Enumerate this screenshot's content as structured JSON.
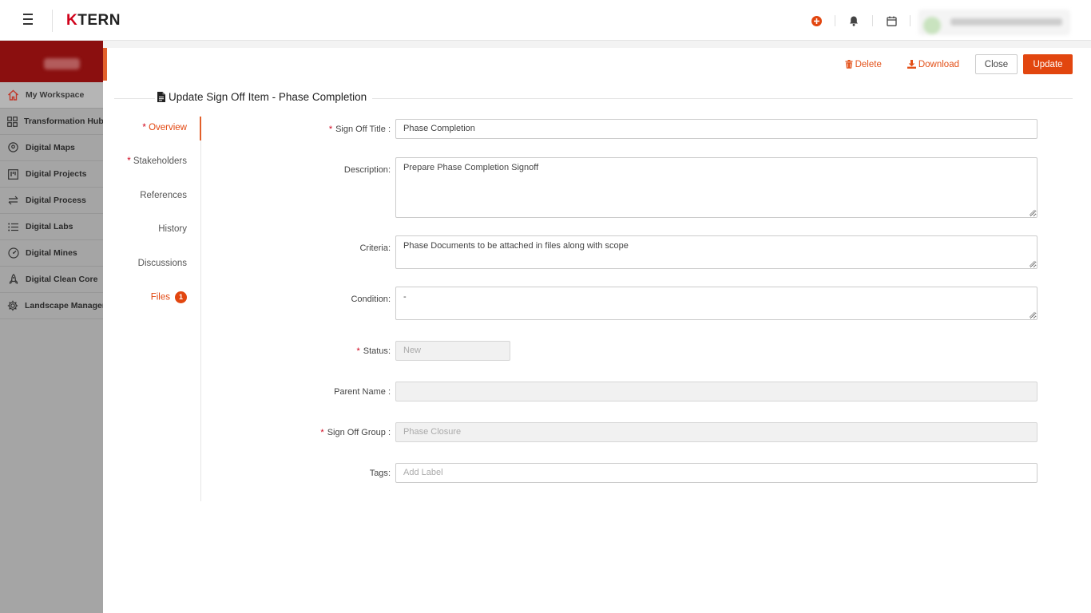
{
  "app": {
    "logo": "KTERN",
    "logo_k": "K",
    "logo_rest": "TERN"
  },
  "sidebar": {
    "items": [
      {
        "label": "My Workspace",
        "icon": "home-icon",
        "active": true
      },
      {
        "label": "Transformation Hub",
        "icon": "grid-icon"
      },
      {
        "label": "Digital Maps",
        "icon": "map-pin-icon"
      },
      {
        "label": "Digital Projects",
        "icon": "kanban-icon"
      },
      {
        "label": "Digital Process",
        "icon": "arrows-swap-icon"
      },
      {
        "label": "Digital Labs",
        "icon": "list-icon"
      },
      {
        "label": "Digital Mines",
        "icon": "gauge-icon"
      },
      {
        "label": "Digital Clean Core",
        "icon": "rocket-icon"
      },
      {
        "label": "Landscape Management",
        "icon": "gear-icon"
      }
    ]
  },
  "actions": {
    "delete": "Delete",
    "download": "Download",
    "close": "Close",
    "update": "Update"
  },
  "page": {
    "title": "Update Sign Off Item - Phase Completion"
  },
  "tabs": {
    "overview": "Overview",
    "stakeholders": "Stakeholders",
    "references": "References",
    "history": "History",
    "discussions": "Discussions",
    "files": "Files",
    "files_count": "1"
  },
  "form": {
    "title_label": "Sign Off Title",
    "title_value": "Phase Completion",
    "description_label": "Description",
    "description_value": "Prepare Phase Completion Signoff",
    "criteria_label": "Criteria",
    "criteria_value": "Phase Documents to be attached in files along with scope",
    "condition_label": "Condition",
    "condition_value": "-",
    "status_label": "Status",
    "status_value": "New",
    "parent_label": "Parent Name",
    "parent_value": "",
    "group_label": "Sign Off Group",
    "group_value": "Phase Closure",
    "tags_label": "Tags",
    "tags_placeholder": "Add Label",
    "colon": ":"
  },
  "colors": {
    "accent": "#e2460f",
    "required": "#d0021b"
  }
}
